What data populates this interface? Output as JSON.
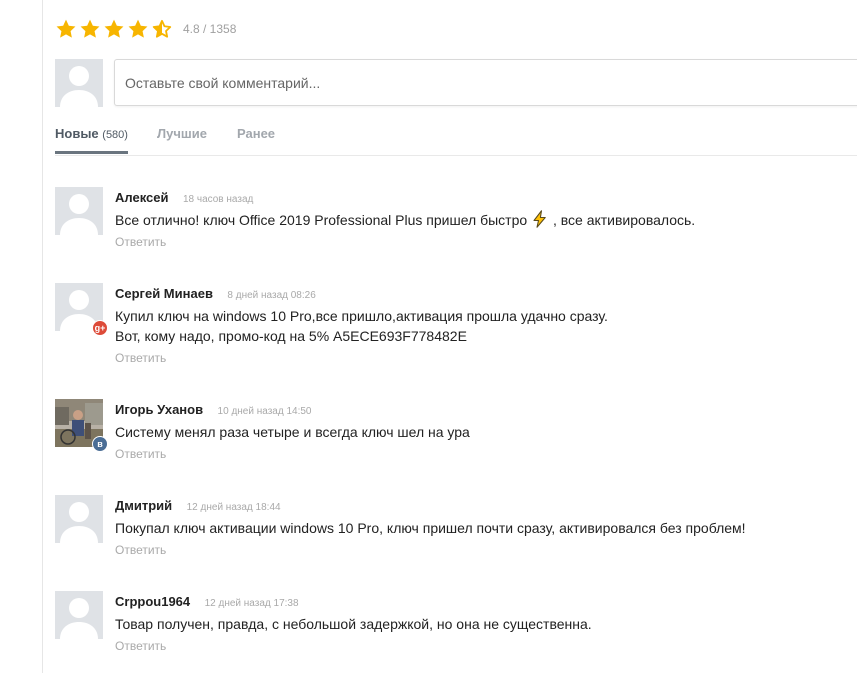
{
  "rating": {
    "stars_filled": 4.5,
    "stars_total": 5,
    "text": "4.8 / 1358",
    "star_color": "#f7b500"
  },
  "composer": {
    "placeholder": "Оставьте свой комментарий..."
  },
  "tabs": [
    {
      "label": "Новые",
      "count": "(580)",
      "active": true
    },
    {
      "label": "Лучшие",
      "active": false
    },
    {
      "label": "Ранее",
      "active": false
    }
  ],
  "comments": [
    {
      "author": "Алексей",
      "time": "18 часов назад",
      "text_before": "Все отлично! ключ Office 2019 Professional Plus пришел быстро",
      "emoji": "high-voltage-emoji",
      "text_after": ", все активировалось.",
      "reply": "Ответить",
      "avatar": "default-avatar"
    },
    {
      "author": "Сергей Минаев",
      "time": "8 дней назад 08:26",
      "lines": [
        "Купил ключ на windows 10 Pro,все пришло,активация прошла удачно сразу.",
        "Вот, кому надо, промо-код на 5% A5ECE693F778482E"
      ],
      "reply": "Ответить",
      "avatar": "default-avatar",
      "social": "g+"
    },
    {
      "author": "Игорь Уханов",
      "time": "10 дней назад 14:50",
      "text": "Систему менял раза четыре и всегда ключ шел на ура",
      "reply": "Ответить",
      "avatar": "photo-avatar",
      "social": "в"
    },
    {
      "author": "Дмитрий",
      "time": "12 дней назад 18:44",
      "text": "Покупал ключ активации windows 10 Pro, ключ пришел почти сразу, активировался без проблем!",
      "reply": "Ответить",
      "avatar": "default-avatar"
    },
    {
      "author": "Crppou1964",
      "time": "12 дней назад 17:38",
      "text": "Товар получен, правда, с небольшой задержкой, но она не существенна.",
      "reply": "Ответить",
      "avatar": "default-avatar"
    }
  ]
}
